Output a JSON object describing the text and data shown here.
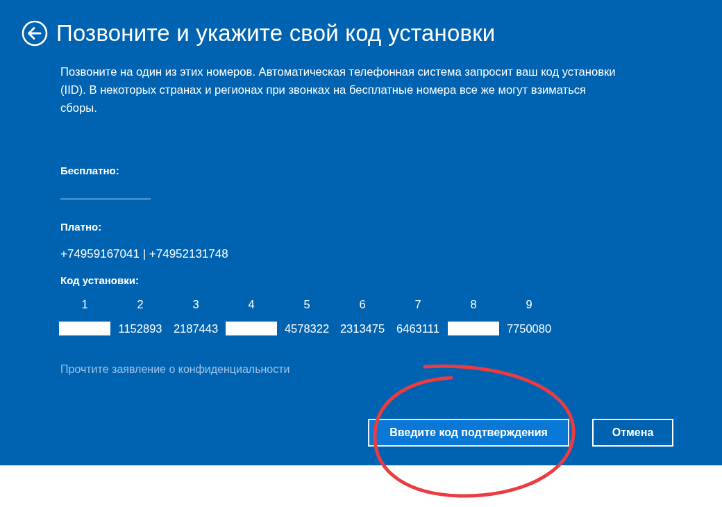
{
  "header": {
    "title": "Позвоните и укажите свой код установки"
  },
  "intro": "Позвоните на один из этих номеров. Автоматическая телефонная система запросит ваш код установки (IID). В некоторых странах и регионах при звонках на бесплатные номера все же могут взиматься сборы.",
  "toll_free": {
    "label": "Бесплатно:",
    "blank": true
  },
  "paid": {
    "label": "Платно:",
    "numbers": "+74959167041 | +74952131748"
  },
  "install_code": {
    "label": "Код установки:",
    "groups": [
      {
        "number": "1",
        "redacted": true
      },
      {
        "number": "2",
        "value": "1152893",
        "redacted": false
      },
      {
        "number": "3",
        "value": "2187443",
        "redacted": false
      },
      {
        "number": "4",
        "redacted": true
      },
      {
        "number": "5",
        "value": "4578322",
        "redacted": false
      },
      {
        "number": "6",
        "value": "2313475",
        "redacted": false
      },
      {
        "number": "7",
        "value": "6463111",
        "redacted": false
      },
      {
        "number": "8",
        "redacted": true
      },
      {
        "number": "9",
        "value": "7750080",
        "redacted": false
      }
    ]
  },
  "privacy_link": "Прочтите заявление о конфиденциальности",
  "buttons": [
    {
      "label": "Введите код подтверждения",
      "kind": "primary"
    },
    {
      "label": "Отмена",
      "kind": "secondary"
    }
  ],
  "annotation": {
    "kind": "ellipse"
  }
}
